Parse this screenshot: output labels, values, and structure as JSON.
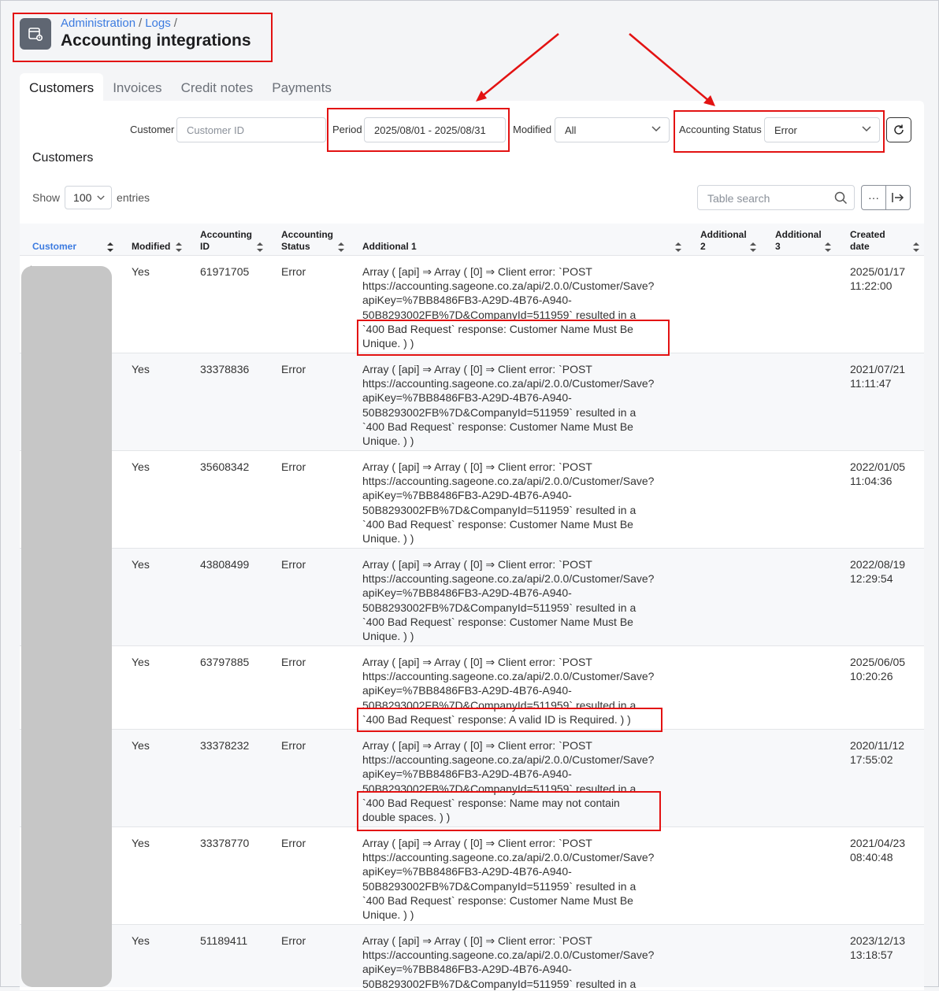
{
  "header": {
    "breadcrumb": [
      "Administration",
      "Logs"
    ],
    "breadcrumb_sep": "/",
    "title": "Accounting integrations",
    "icon": "log-document-icon"
  },
  "tabs": [
    {
      "label": "Customers",
      "active": true
    },
    {
      "label": "Invoices",
      "active": false
    },
    {
      "label": "Credit notes",
      "active": false
    },
    {
      "label": "Payments",
      "active": false
    }
  ],
  "filters": {
    "customer_label": "Customer",
    "customer_placeholder": "Customer ID",
    "period_label": "Period",
    "period_value": "2025/08/01 - 2025/08/31",
    "modified_label": "Modified",
    "modified_value": "All",
    "status_label": "Accounting Status",
    "status_value": "Error"
  },
  "section_title": "Customers",
  "list_controls": {
    "show_label": "Show",
    "entries_value": "100",
    "entries_label": "entries",
    "search_placeholder": "Table search",
    "more_label": "···"
  },
  "columns": {
    "customer": "Customer",
    "modified": "Modified",
    "accounting_id_1": "Accounting",
    "accounting_id_2": "ID",
    "accounting_status_1": "Accounting",
    "accounting_status_2": "Status",
    "additional1": "Additional 1",
    "additional2_1": "Additional",
    "additional2_2": "2",
    "additional3_1": "Additional",
    "additional3_2": "3",
    "created_1": "Created",
    "created_2": "date"
  },
  "rows": [
    {
      "modified": "Yes",
      "accounting_id": "61971705",
      "status": "Error",
      "msg": [
        "Array ( [api] ⇒ Array ( [0] ⇒ Client error: `POST",
        "https://accounting.sageone.co.za/api/2.0.0/Customer/Save?",
        "apiKey=%7BB8486FB3-A29D-4B76-A940-",
        "50B8293002FB%7D&CompanyId=511959` resulted in a",
        "`400 Bad Request` response: Customer Name Must Be",
        "Unique. ) )"
      ],
      "date": "2025/01/17",
      "time": "11:22:00"
    },
    {
      "modified": "Yes",
      "accounting_id": "33378836",
      "status": "Error",
      "msg": [
        "Array ( [api] ⇒ Array ( [0] ⇒ Client error: `POST",
        "https://accounting.sageone.co.za/api/2.0.0/Customer/Save?",
        "apiKey=%7BB8486FB3-A29D-4B76-A940-",
        "50B8293002FB%7D&CompanyId=511959` resulted in a",
        "`400 Bad Request` response: Customer Name Must Be",
        "Unique. ) )"
      ],
      "date": "2021/07/21",
      "time": "11:11:47"
    },
    {
      "modified": "Yes",
      "accounting_id": "35608342",
      "status": "Error",
      "msg": [
        "Array ( [api] ⇒ Array ( [0] ⇒ Client error: `POST",
        "https://accounting.sageone.co.za/api/2.0.0/Customer/Save?",
        "apiKey=%7BB8486FB3-A29D-4B76-A940-",
        "50B8293002FB%7D&CompanyId=511959` resulted in a",
        "`400 Bad Request` response: Customer Name Must Be",
        "Unique. ) )"
      ],
      "date": "2022/01/05",
      "time": "11:04:36"
    },
    {
      "modified": "Yes",
      "accounting_id": "43808499",
      "status": "Error",
      "msg": [
        "Array ( [api] ⇒ Array ( [0] ⇒ Client error: `POST",
        "https://accounting.sageone.co.za/api/2.0.0/Customer/Save?",
        "apiKey=%7BB8486FB3-A29D-4B76-A940-",
        "50B8293002FB%7D&CompanyId=511959` resulted in a",
        "`400 Bad Request` response: Customer Name Must Be",
        "Unique. ) )"
      ],
      "date": "2022/08/19",
      "time": "12:29:54"
    },
    {
      "modified": "Yes",
      "accounting_id": "63797885",
      "status": "Error",
      "msg": [
        "Array ( [api] ⇒ Array ( [0] ⇒ Client error: `POST",
        "https://accounting.sageone.co.za/api/2.0.0/Customer/Save?",
        "apiKey=%7BB8486FB3-A29D-4B76-A940-",
        "50B8293002FB%7D&CompanyId=511959` resulted in a",
        "`400 Bad Request` response: A valid ID is Required. ) )"
      ],
      "date": "2025/06/05",
      "time": "10:20:26"
    },
    {
      "modified": "Yes",
      "accounting_id": "33378232",
      "status": "Error",
      "msg": [
        "Array ( [api] ⇒ Array ( [0] ⇒ Client error: `POST",
        "https://accounting.sageone.co.za/api/2.0.0/Customer/Save?",
        "apiKey=%7BB8486FB3-A29D-4B76-A940-",
        "50B8293002FB%7D&CompanyId=511959` resulted in a",
        "`400 Bad Request` response: Name may not contain",
        "double spaces. ) )"
      ],
      "date": "2020/11/12",
      "time": "17:55:02"
    },
    {
      "modified": "Yes",
      "accounting_id": "33378770",
      "status": "Error",
      "msg": [
        "Array ( [api] ⇒ Array ( [0] ⇒ Client error: `POST",
        "https://accounting.sageone.co.za/api/2.0.0/Customer/Save?",
        "apiKey=%7BB8486FB3-A29D-4B76-A940-",
        "50B8293002FB%7D&CompanyId=511959` resulted in a",
        "`400 Bad Request` response: Customer Name Must Be",
        "Unique. ) )"
      ],
      "date": "2021/04/23",
      "time": "08:40:48"
    },
    {
      "modified": "Yes",
      "accounting_id": "51189411",
      "status": "Error",
      "msg": [
        "Array ( [api] ⇒ Array ( [0] ⇒ Client error: `POST",
        "https://accounting.sageone.co.za/api/2.0.0/Customer/Save?",
        "apiKey=%7BB8486FB3-A29D-4B76-A940-",
        "50B8293002FB%7D&CompanyId=511959` resulted in a"
      ],
      "date": "2023/12/13",
      "time": "13:18:57"
    }
  ],
  "colors": {
    "link": "#3c7be0",
    "highlight": "#e31212",
    "redaction": "#c6c6c6"
  }
}
